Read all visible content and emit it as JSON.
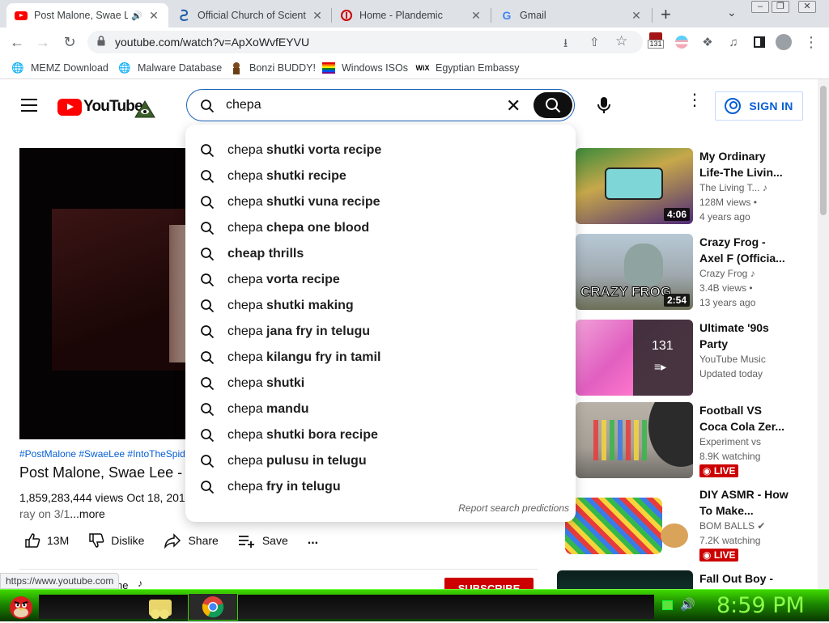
{
  "browser": {
    "tabs": [
      {
        "title": "Post Malone, Swae Le",
        "favicon": "youtube-icon",
        "active": true,
        "audio": true
      },
      {
        "title": "Official Church of Sciento",
        "favicon": "scientology-icon",
        "active": false
      },
      {
        "title": "Home - Plandemic",
        "favicon": "plandemic-icon",
        "active": false
      },
      {
        "title": "Gmail",
        "favicon": "google-icon",
        "active": false
      }
    ],
    "new_tab_glyph": "+",
    "url": "youtube.com/watch?v=ApXoWvfEYVU",
    "extension_badge": "131",
    "bookmarks": [
      {
        "label": "MEMZ Download",
        "icon": "globe-icon"
      },
      {
        "label": "Malware Database",
        "icon": "globe-icon"
      },
      {
        "label": "Bonzi BUDDY!",
        "icon": "bonzi-icon"
      },
      {
        "label": "Windows ISOs",
        "icon": "windows-flag-icon"
      },
      {
        "label": "Egyptian Embassy",
        "icon": "wix-icon"
      }
    ]
  },
  "youtube": {
    "logo_text": "YouTube",
    "search": {
      "query": "chepa ",
      "suggestions": [
        {
          "prefix": "chepa ",
          "completion": "shutki vorta recipe"
        },
        {
          "prefix": "chepa ",
          "completion": "shutki recipe"
        },
        {
          "prefix": "chepa ",
          "completion": "shutki vuna recipe"
        },
        {
          "prefix": "chepa ",
          "completion": "chepa one blood"
        },
        {
          "prefix": "",
          "completion": "cheap thrills"
        },
        {
          "prefix": "chepa ",
          "completion": "vorta recipe"
        },
        {
          "prefix": "chepa ",
          "completion": "shutki making"
        },
        {
          "prefix": "chepa ",
          "completion": "jana fry in telugu"
        },
        {
          "prefix": "chepa ",
          "completion": "kilangu fry in tamil"
        },
        {
          "prefix": "chepa ",
          "completion": "shutki"
        },
        {
          "prefix": "chepa ",
          "completion": "mandu"
        },
        {
          "prefix": "chepa ",
          "completion": "shutki bora recipe"
        },
        {
          "prefix": "chepa ",
          "completion": "pulusu in telugu"
        },
        {
          "prefix": "chepa ",
          "completion": "fry in telugu"
        }
      ],
      "report_label": "Report search predictions"
    },
    "signin_label": "SIGN IN",
    "video": {
      "hashtags": "#PostMalone #SwaeLee #IntoTheSpid",
      "title": "Post Malone, Swae Lee -",
      "views": "1,859,283,444 views  Oct 18, 201",
      "desc_start": "ray on 3/1",
      "more": "...more",
      "like_count": "13M",
      "dislike_label": "Dislike",
      "share_label": "Share",
      "save_label": "Save",
      "more_glyph": "...",
      "channel_fragment": "ne",
      "subscribe_label": "SUBSCRIBE"
    },
    "sidebar": [
      {
        "title": "My Ordinary Life-The Livin...",
        "channel": "The Living T...",
        "meta1": "128M views •",
        "meta2": "4 years ago",
        "duration": "4:06",
        "verified": "music-note-icon"
      },
      {
        "title": "Crazy Frog - Axel F (Officia...",
        "channel": "Crazy Frog",
        "meta1": "3.4B views •",
        "meta2": "13 years ago",
        "duration": "2:54",
        "verified": "music-note-icon"
      },
      {
        "title": "Ultimate '90s Party",
        "channel": "YouTube Music",
        "meta1": "Updated today",
        "meta2": "",
        "playlist_count": "131"
      },
      {
        "title": "Football VS Coca Cola Zer...",
        "channel": "Experiment vs",
        "meta1": "8.9K watching",
        "live_badge": "LIVE"
      },
      {
        "title": "DIY ASMR - How To Make...",
        "channel": "BOM BALLS",
        "meta1": "7.2K watching",
        "live_badge": "LIVE",
        "verified": "check-circle-icon"
      },
      {
        "title": "Fall Out Boy -",
        "channel": "",
        "meta1": ""
      }
    ],
    "status_url": "https://www.youtube.com"
  },
  "taskbar": {
    "clock": "8:59 PM",
    "accent": "#2fc000"
  }
}
